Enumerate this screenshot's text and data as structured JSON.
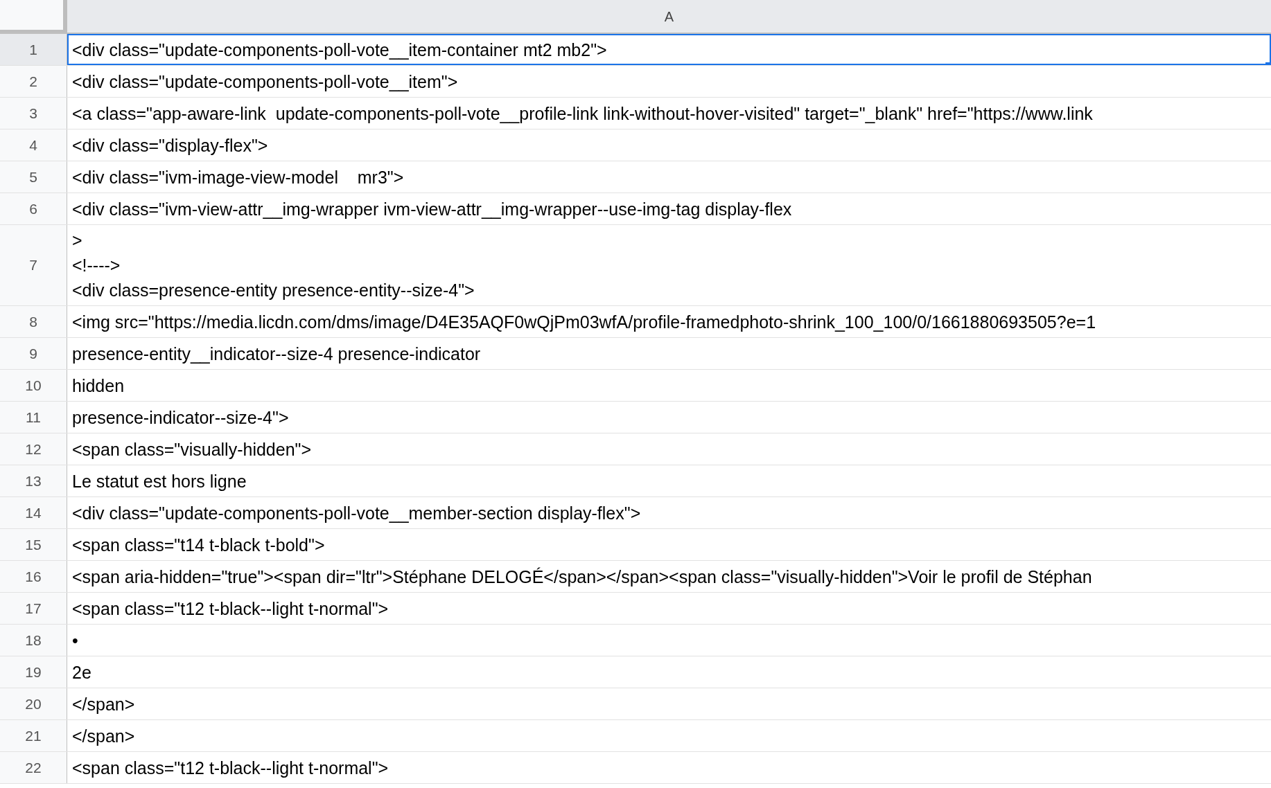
{
  "columns": [
    {
      "label": "A",
      "selected": true
    }
  ],
  "rows": [
    {
      "number": "1",
      "selected": true,
      "lines": [
        "<div class=\"update-components-poll-vote__item-container mt2 mb2\">"
      ]
    },
    {
      "number": "2",
      "selected": false,
      "lines": [
        "<div class=\"update-components-poll-vote__item\">"
      ]
    },
    {
      "number": "3",
      "selected": false,
      "lines": [
        "<a class=\"app-aware-link  update-components-poll-vote__profile-link link-without-hover-visited\" target=\"_blank\" href=\"https://www.link"
      ]
    },
    {
      "number": "4",
      "selected": false,
      "lines": [
        "<div class=\"display-flex\">"
      ]
    },
    {
      "number": "5",
      "selected": false,
      "lines": [
        "<div class=\"ivm-image-view-model    mr3\">"
      ]
    },
    {
      "number": "6",
      "selected": false,
      "lines": [
        "<div class=\"ivm-view-attr__img-wrapper ivm-view-attr__img-wrapper--use-img-tag display-flex"
      ]
    },
    {
      "number": "7",
      "selected": false,
      "lines": [
        ">",
        "<!---->",
        "<div class=presence-entity presence-entity--size-4\">"
      ]
    },
    {
      "number": "8",
      "selected": false,
      "lines": [
        "<img src=\"https://media.licdn.com/dms/image/D4E35AQF0wQjPm03wfA/profile-framedphoto-shrink_100_100/0/1661880693505?e=1"
      ]
    },
    {
      "number": "9",
      "selected": false,
      "lines": [
        "presence-entity__indicator--size-4 presence-indicator"
      ]
    },
    {
      "number": "10",
      "selected": false,
      "lines": [
        "hidden"
      ]
    },
    {
      "number": "11",
      "selected": false,
      "lines": [
        "presence-indicator--size-4\">"
      ]
    },
    {
      "number": "12",
      "selected": false,
      "lines": [
        "<span class=\"visually-hidden\">"
      ]
    },
    {
      "number": "13",
      "selected": false,
      "lines": [
        "Le statut est hors ligne"
      ]
    },
    {
      "number": "14",
      "selected": false,
      "lines": [
        "<div class=\"update-components-poll-vote__member-section display-flex\">"
      ]
    },
    {
      "number": "15",
      "selected": false,
      "lines": [
        "<span class=\"t14 t-black t-bold\">"
      ]
    },
    {
      "number": "16",
      "selected": false,
      "lines": [
        "<span aria-hidden=\"true\"><span dir=\"ltr\">Stéphane DELOGÉ</span></span><span class=\"visually-hidden\">Voir le profil de Stéphan"
      ]
    },
    {
      "number": "17",
      "selected": false,
      "lines": [
        "<span class=\"t12 t-black--light t-normal\">"
      ]
    },
    {
      "number": "18",
      "selected": false,
      "lines": [
        "•"
      ]
    },
    {
      "number": "19",
      "selected": false,
      "lines": [
        "2e"
      ]
    },
    {
      "number": "20",
      "selected": false,
      "lines": [
        "</span>"
      ]
    },
    {
      "number": "21",
      "selected": false,
      "lines": [
        "</span>"
      ]
    },
    {
      "number": "22",
      "selected": false,
      "lines": [
        "<span class=\"t12 t-black--light t-normal\">"
      ]
    }
  ]
}
